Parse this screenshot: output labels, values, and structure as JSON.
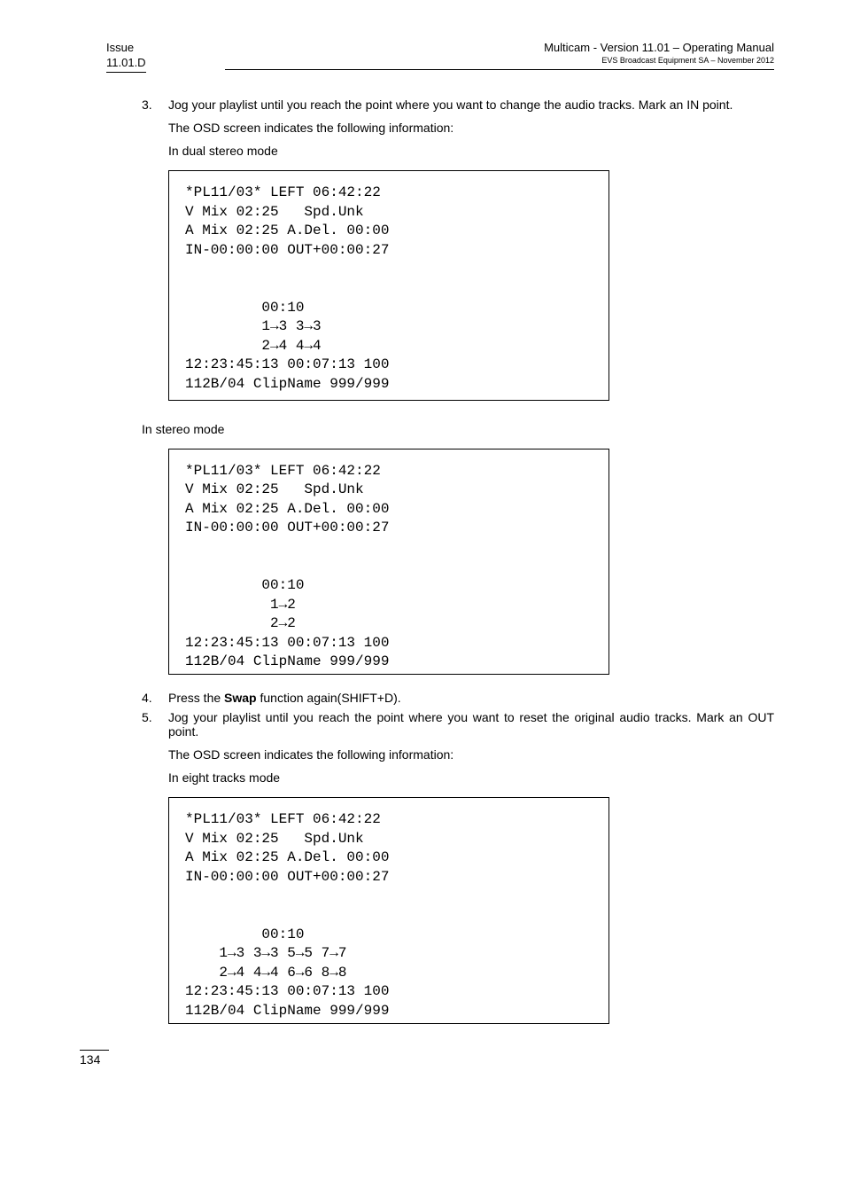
{
  "header": {
    "issue_label": "Issue",
    "revision": "11.01.D",
    "title_line": "Multicam - Version 11.01 – Operating Manual",
    "sub_line": "EVS Broadcast Equipment SA – November 2012"
  },
  "steps": {
    "s3_num": "3.",
    "s3_text": "Jog your playlist until you reach the point where you want to change the audio tracks. Mark an IN point.",
    "s3_p1": "The OSD screen indicates the following information:",
    "s3_p2": "In dual stereo mode",
    "s3_mid_label": "In stereo mode",
    "s4_num": "4.",
    "s4_text_pre": "Press the ",
    "s4_bold": "Swap",
    "s4_text_post": " function again(SHIFT+D).",
    "s5_num": "5.",
    "s5_text": "Jog your playlist until you reach the point where you want to reset the original audio tracks. Mark an OUT point.",
    "s5_p1": "The OSD screen indicates the following information:",
    "s5_p2": "In eight tracks mode"
  },
  "osd1": {
    "l1": "*PL11/03* LEFT 06:42:22",
    "l2": "V Mix 02:25   Spd.Unk",
    "l3": "A Mix 02:25 A.Del. 00:00",
    "l4": "IN-00:00:00 OUT+00:00:27",
    "l5": "",
    "l6": "",
    "l7": "         00:10",
    "l8": "         1→3 3→3",
    "l9": "         2→4 4→4",
    "l10": "12:23:45:13 00:07:13 100",
    "l11": "112B/04 ClipName 999/999"
  },
  "osd2": {
    "l1": "*PL11/03* LEFT 06:42:22",
    "l2": "V Mix 02:25   Spd.Unk",
    "l3": "A Mix 02:25 A.Del. 00:00",
    "l4": "IN-00:00:00 OUT+00:00:27",
    "l5": "",
    "l6": "",
    "l7": "         00:10",
    "l8": "          1→2",
    "l9": "          2→2",
    "l10": "12:23:45:13 00:07:13 100",
    "l11": "112B/04 ClipName 999/999"
  },
  "osd3": {
    "l1": "*PL11/03* LEFT 06:42:22",
    "l2": "V Mix 02:25   Spd.Unk",
    "l3": "A Mix 02:25 A.Del. 00:00",
    "l4": "IN-00:00:00 OUT+00:00:27",
    "l5": "",
    "l6": "",
    "l7": "         00:10",
    "l8": "    1→3 3→3 5→5 7→7",
    "l9": "    2→4 4→4 6→6 8→8",
    "l10": "12:23:45:13 00:07:13 100",
    "l11": "112B/04 ClipName 999/999"
  },
  "footer": {
    "page_number": "134"
  }
}
